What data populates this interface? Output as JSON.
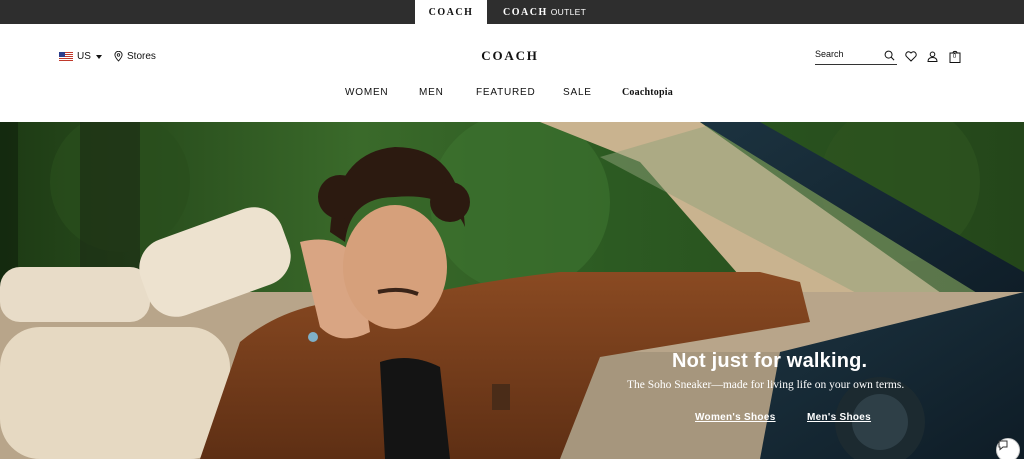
{
  "brandbar": {
    "coach_label": "COACH",
    "outlet_brand": "COACH",
    "outlet_suffix": "OUTLET"
  },
  "header": {
    "country": "US",
    "stores_label": "Stores",
    "logo": "COACH",
    "search_placeholder": "Search",
    "bag_count": "0"
  },
  "nav": {
    "items": [
      "WOMEN",
      "MEN",
      "FEATURED",
      "SALE",
      "Coachtopia"
    ]
  },
  "hero": {
    "headline": "Not just for walking.",
    "subheadline": "The Soho Sneaker—made for living life on your own terms.",
    "links": [
      "Women's Shoes",
      "Men's Shoes"
    ]
  }
}
